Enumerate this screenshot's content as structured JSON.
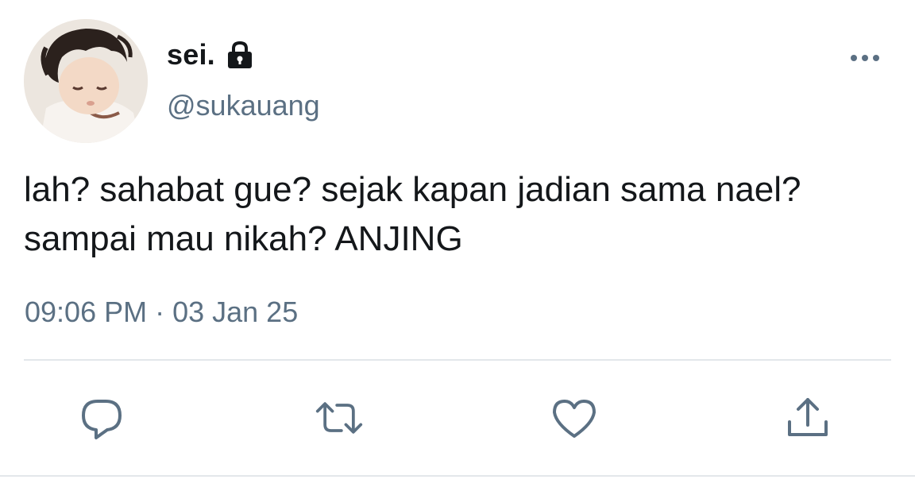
{
  "tweet": {
    "display_name": "sei.",
    "username": "@sukauang",
    "text": "lah? sahabat gue? sejak kapan jadian sama nael? sampai mau nikah? ANJING",
    "time": "09:06 PM",
    "separator": "·",
    "date": "03 Jan 25"
  },
  "icons": {
    "lock": "lock-icon",
    "more": "more-horizontal-icon",
    "reply": "reply-icon",
    "retweet": "retweet-icon",
    "like": "heart-icon",
    "share": "share-icon"
  },
  "colors": {
    "primary_text": "#14171a",
    "secondary_text": "#5b7083",
    "divider": "#e3e7eb",
    "icon": "#5b7083"
  }
}
